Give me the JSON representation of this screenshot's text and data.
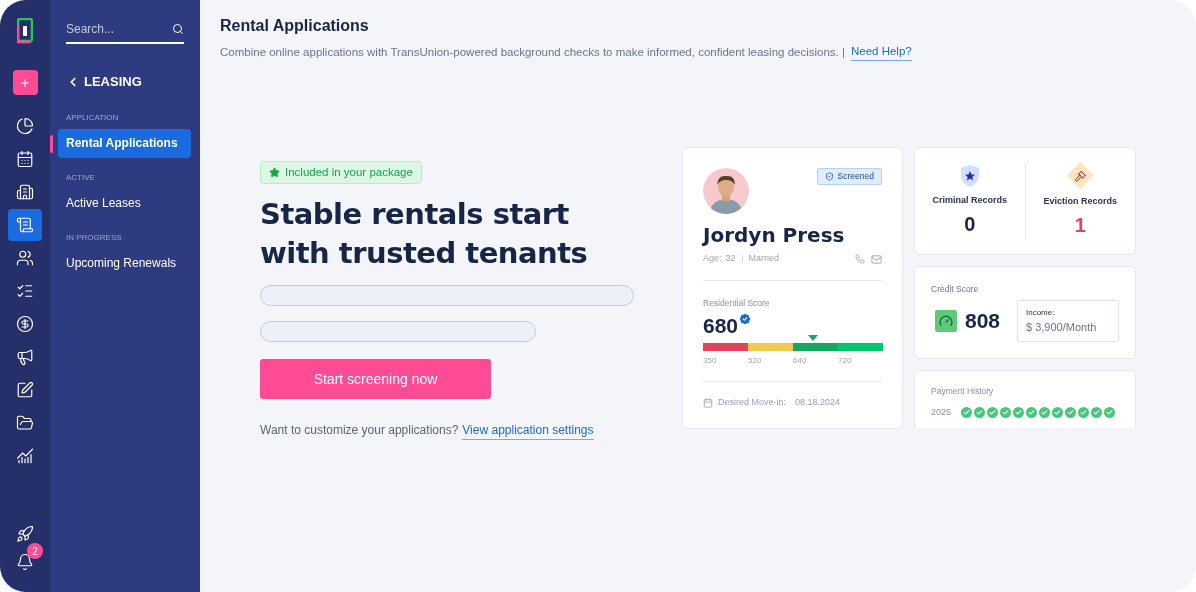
{
  "rail": {
    "badge": "2",
    "items": [
      {
        "selected": false
      },
      {
        "selected": false
      },
      {
        "selected": false
      },
      {
        "selected": true
      },
      {
        "selected": false
      },
      {
        "selected": false
      },
      {
        "selected": false
      },
      {
        "selected": false
      },
      {
        "selected": false
      },
      {
        "selected": false
      },
      {
        "selected": false
      }
    ]
  },
  "sidebar": {
    "search": {
      "placeholder": "Search..."
    },
    "back": "LEASING",
    "sections": [
      {
        "heading": "APPLICATION",
        "items": [
          {
            "label": "Rental Applications",
            "selected": true
          }
        ]
      },
      {
        "heading": "ACTIVE",
        "items": [
          {
            "label": "Active Leases",
            "selected": false
          }
        ]
      },
      {
        "heading": "IN PROGRESS",
        "items": [
          {
            "label": "Upcoming Renewals",
            "selected": false
          }
        ]
      }
    ]
  },
  "header": {
    "title": "Rental Applications",
    "subtitle": "Combine online applications with TransUnion-powered background checks to make informed, confident leasing decisions. |",
    "help": "Need Help?"
  },
  "promo": {
    "badge": "Included in your package",
    "headline": "Stable rentals start with trusted tenants",
    "button": "Start screening now",
    "footer": "Want to customize your applications?",
    "footer_link": "View application settings"
  },
  "profile": {
    "status": "Screened",
    "name": "Jordyn Press",
    "age_label": "Age:",
    "age": "32",
    "marital": "Married",
    "score_label": "Residential Score",
    "score": "680",
    "ticks": [
      "350",
      "520",
      "640",
      "720"
    ],
    "move_in_label": "Desired Move-in:",
    "move_in": "08.18.2024"
  },
  "records": [
    {
      "kind": "criminal",
      "label": "Criminal Records",
      "value": "0",
      "alert": false
    },
    {
      "kind": "eviction",
      "label": "Eviction Records",
      "value": "1",
      "alert": true
    }
  ],
  "credit": {
    "label": "Credit Score",
    "score": "808",
    "income_label": "Income:",
    "income": "$ 3,900/Month"
  },
  "payment_history": {
    "title": "Payment History",
    "year": "2025",
    "months": [
      {
        "paid": true
      },
      {
        "paid": true
      },
      {
        "paid": true
      },
      {
        "paid": true
      },
      {
        "paid": true
      },
      {
        "paid": true
      },
      {
        "paid": true
      },
      {
        "paid": true
      },
      {
        "paid": true
      },
      {
        "paid": true
      },
      {
        "paid": true
      },
      {
        "paid": true
      }
    ]
  }
}
